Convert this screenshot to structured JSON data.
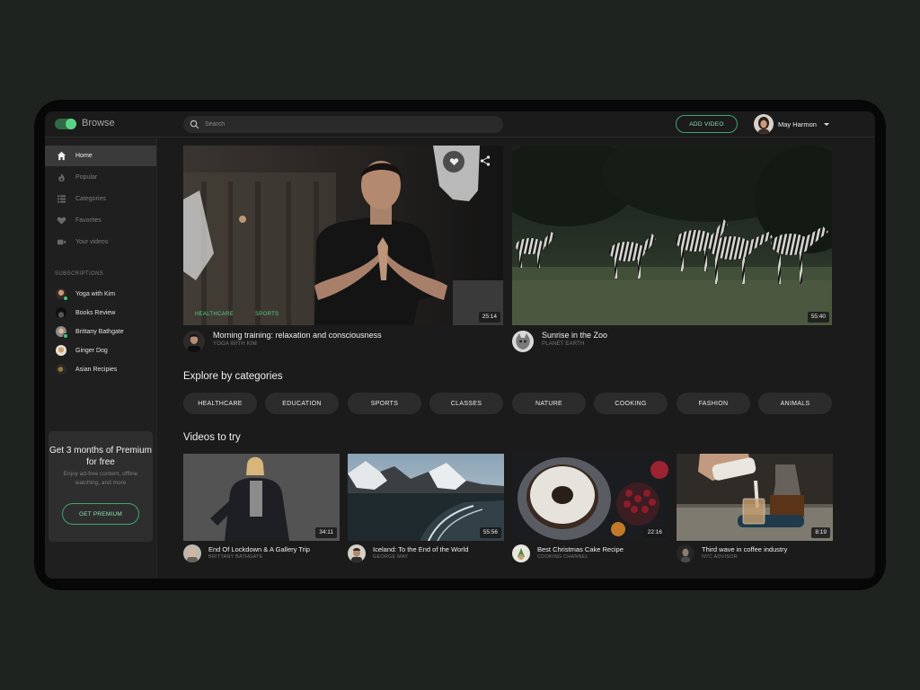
{
  "app": {
    "brand": "Browse"
  },
  "search": {
    "placeholder": "Search",
    "icon": "search-icon"
  },
  "header": {
    "add_video_label": "ADD VIDEO",
    "user_name": "May Harmon",
    "accent_color": "#4fc47f"
  },
  "sidebar": {
    "nav": [
      {
        "label": "Home",
        "icon": "home-icon",
        "active": true
      },
      {
        "label": "Popular",
        "icon": "flame-icon"
      },
      {
        "label": "Categories",
        "icon": "list-icon"
      },
      {
        "label": "Favorites",
        "icon": "heart-icon"
      },
      {
        "label": "Your videos",
        "icon": "video-camera-icon"
      }
    ],
    "subscriptions_title": "SUBSCRIPTIONS",
    "subscriptions": [
      {
        "label": "Yoga with Kim",
        "online": true
      },
      {
        "label": "Books Review",
        "online": false
      },
      {
        "label": "Brittany Bathgate",
        "online": true
      },
      {
        "label": "Ginger Dog",
        "online": false
      },
      {
        "label": "Asian Recipies",
        "online": false
      }
    ],
    "promo": {
      "title": "Get 3 months of Premium for free",
      "text": "Enjoy ad-free content, offline watching, and more",
      "button_label": "GET PREMIUM"
    }
  },
  "featured": [
    {
      "title": "Morning training: relaxation and consciousness",
      "channel": "YOGA WITH KIM",
      "duration": "25:14",
      "tags": [
        "HEALTHCARE",
        "SPORTS"
      ]
    },
    {
      "title": "Sunrise in the Zoo",
      "channel": "PLANET EARTH",
      "duration": "55:40"
    }
  ],
  "categories": {
    "title": "Explore by categories",
    "items": [
      "HEALTHCARE",
      "EDUCATION",
      "SPORTS",
      "CLASSES",
      "NATURE",
      "COOKING",
      "FASHION",
      "ANIMALS"
    ]
  },
  "videos": {
    "title": "Videos to try",
    "items": [
      {
        "title": "End Of Lockdown & A Gallery Trip",
        "channel": "BRITTANY BATHGATE",
        "duration": "34:11"
      },
      {
        "title": "Iceland: To the End of the World",
        "channel": "GEORGE MAY",
        "duration": "55:56"
      },
      {
        "title": "Best Christmas Cake Recipe",
        "channel": "COOKING CHANNEL",
        "duration": "22:16"
      },
      {
        "title": "Third wave in coffee industry",
        "channel": "NYC ADVISOR",
        "duration": "8:19"
      }
    ]
  }
}
